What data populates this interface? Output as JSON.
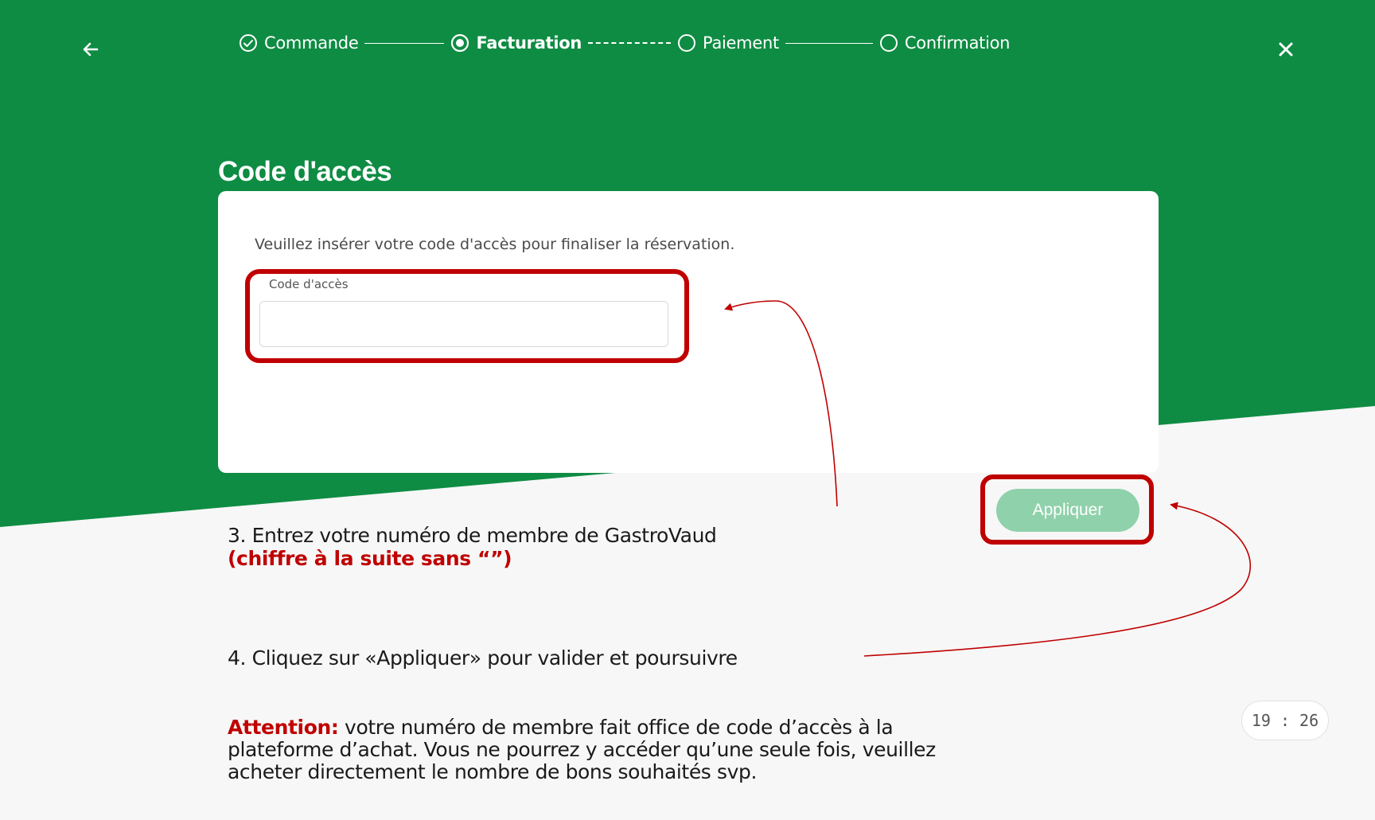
{
  "steps": [
    {
      "label": "Commande",
      "state": "done"
    },
    {
      "label": "Facturation",
      "state": "active"
    },
    {
      "label": "Paiement",
      "state": "todo"
    },
    {
      "label": "Confirmation",
      "state": "todo"
    }
  ],
  "section": {
    "title": "Code d'accès",
    "description": "Veuillez insérer votre code d'accès pour finaliser la réservation.",
    "field_label": "Code d'accès",
    "field_value": "",
    "apply_label": "Appliquer"
  },
  "instructions": {
    "step3_text": "3. Entrez votre numéro de membre de GastroVaud",
    "step3_note": "(chiffre à la suite sans “”)",
    "step4_text": "4. Cliquez sur «Appliquer» pour valider et poursuivre",
    "attention_label": "Attention:",
    "attention_text": " votre numéro de membre fait office de code d’accès à la plateforme d’achat. Vous ne pourrez y accéder qu’une seule fois, veuillez acheter directement le nombre de bons souhaités svp."
  },
  "timer": "19 : 26",
  "colors": {
    "brand_green": "#0f8c43",
    "annotation_red": "#c00000",
    "button_disabled": "#8fd1ab"
  },
  "icons": {
    "back": "arrow-left-icon",
    "close": "close-icon",
    "step_done": "check-circle-icon",
    "step_active": "radio-filled-icon",
    "step_todo": "circle-icon"
  }
}
